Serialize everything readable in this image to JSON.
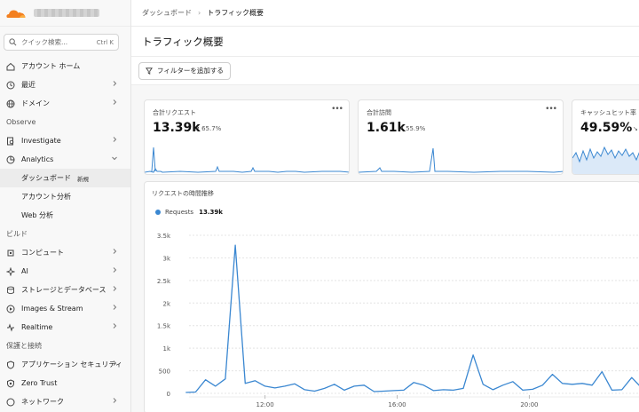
{
  "sidebar": {
    "search": {
      "placeholder": "クイック検索...",
      "shortcut": "Ctrl K"
    },
    "items": [
      {
        "label": "アカウント ホーム",
        "icon": "home-icon",
        "chev": false
      },
      {
        "label": "最近",
        "icon": "clock-icon",
        "chev": true
      },
      {
        "label": "ドメイン",
        "icon": "globe-icon",
        "chev": true
      }
    ],
    "section_observe": "Observe",
    "observe_items": [
      {
        "label": "Investigate",
        "icon": "search-doc-icon",
        "chev": true
      },
      {
        "label": "Analytics",
        "icon": "chart-icon",
        "chev": true,
        "expanded": true
      }
    ],
    "analytics_sub": [
      {
        "label": "ダッシュボード",
        "badge": "新規",
        "active": true
      },
      {
        "label": "アカウント分析"
      },
      {
        "label": "Web 分析"
      }
    ],
    "section_build": "ビルド",
    "build_items": [
      {
        "label": "コンピュート",
        "icon": "cpu-icon",
        "chev": true
      },
      {
        "label": "AI",
        "icon": "sparkle-icon",
        "chev": true
      },
      {
        "label": "ストレージとデータベース",
        "icon": "database-icon",
        "chev": true
      },
      {
        "label": "Images & Stream",
        "icon": "image-icon",
        "chev": true
      },
      {
        "label": "Realtime",
        "icon": "realtime-icon",
        "chev": true
      }
    ],
    "section_security": "保護と接続",
    "security_items": [
      {
        "label": "アプリケーション セキュリティ",
        "icon": "shield-icon",
        "chev": true
      },
      {
        "label": "Zero Trust",
        "icon": "zero-trust-icon",
        "chev": false
      },
      {
        "label": "ネットワーク",
        "icon": "network-icon",
        "chev": true
      }
    ]
  },
  "breadcrumb": {
    "parent": "ダッシュボード",
    "current": "トラフィック概要"
  },
  "page_title": "トラフィック概要",
  "filter_button": "フィルターを追加する",
  "cards": [
    {
      "label": "合計リクエスト",
      "value": "13.39k",
      "change": "65.7%",
      "trend": "up"
    },
    {
      "label": "合計訪問",
      "value": "1.61k",
      "change": "55.9%",
      "trend": "up"
    },
    {
      "label": "キャッシュヒット率",
      "value": "49.59%",
      "change": "",
      "trend": "down"
    }
  ],
  "chart_title": "リクエストの時間推移",
  "colors": {
    "accent": "#3a87d1",
    "brand": "#f38020"
  },
  "chart_data": {
    "type": "line",
    "title": "リクエストの時間推移",
    "legend": [
      {
        "name": "Requests",
        "total": "13.39k"
      }
    ],
    "y_ticks": [
      "0",
      "500",
      "1k",
      "1.5k",
      "2k",
      "2.5k",
      "3k",
      "3.5k"
    ],
    "ylim": [
      0,
      3500
    ],
    "x_ticks": [
      {
        "label": "12:00",
        "x": 12
      },
      {
        "label": "16:00",
        "x": 16
      },
      {
        "label": "20:00",
        "x": 20
      }
    ],
    "series": [
      {
        "name": "Requests",
        "x": [
          9.6,
          9.9,
          10.2,
          10.5,
          10.8,
          11.1,
          11.4,
          11.7,
          12.0,
          12.3,
          12.6,
          12.9,
          13.2,
          13.5,
          13.8,
          14.1,
          14.4,
          14.7,
          15.0,
          15.3,
          15.6,
          15.9,
          16.2,
          16.5,
          16.8,
          17.1,
          17.4,
          17.7,
          18.0,
          18.3,
          18.6,
          18.9,
          19.2,
          19.5,
          19.8,
          20.1,
          20.4,
          20.7,
          21.0,
          21.3,
          21.6,
          21.9,
          22.2,
          22.5,
          22.8,
          23.1,
          23.4
        ],
        "y": [
          20,
          30,
          300,
          160,
          320,
          3280,
          220,
          280,
          160,
          120,
          160,
          210,
          80,
          50,
          110,
          200,
          70,
          160,
          180,
          40,
          50,
          60,
          70,
          240,
          180,
          60,
          80,
          70,
          110,
          850,
          200,
          80,
          180,
          260,
          70,
          90,
          180,
          420,
          220,
          200,
          220,
          180,
          480,
          70,
          80,
          350,
          120
        ]
      }
    ]
  }
}
